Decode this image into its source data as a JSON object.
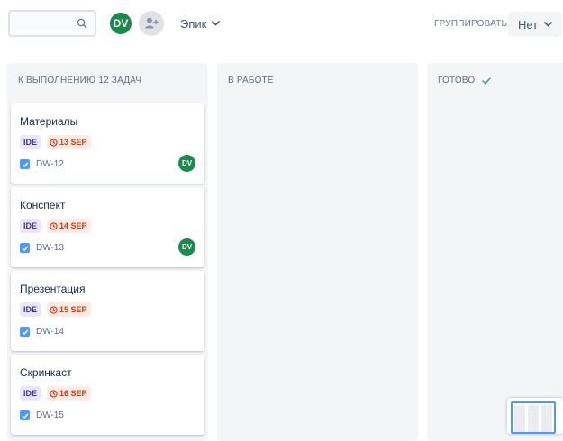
{
  "toolbar": {
    "search": {
      "value": "",
      "placeholder": ""
    },
    "avatar_initials": "DV",
    "epic_label": "Эпик",
    "group_label": "ГРУППИРОВАТЬ:",
    "group_value": "Нет"
  },
  "icons": {
    "search": "search-icon",
    "add_people": "add-people-icon",
    "chevron": "chevron-down-icon",
    "clock": "clock-icon",
    "checkbox": "checkbox-checked-icon",
    "done_check": "check-icon"
  },
  "columns": [
    {
      "title": "К ВЫПОЛНЕНИЮ 12 ЗАДАЧ"
    },
    {
      "title": "В РАБОТЕ"
    },
    {
      "title": "ГОТОВО"
    }
  ],
  "cards": [
    {
      "title": "Материалы",
      "epic": "IDE",
      "due": "13 SEP",
      "key": "DW-12",
      "assignee": "DV"
    },
    {
      "title": "Конспект",
      "epic": "IDE",
      "due": "14 SEP",
      "key": "DW-13",
      "assignee": "DV"
    },
    {
      "title": "Презентация",
      "epic": "IDE",
      "due": "15 SEP",
      "key": "DW-14",
      "assignee": ""
    },
    {
      "title": "Скринкаст",
      "epic": "IDE",
      "due": "16 SEP",
      "key": "DW-15",
      "assignee": ""
    }
  ],
  "colors": {
    "avatar": "#1c8a4c",
    "epic_bg": "#eae6ff",
    "epic_text": "#403294",
    "due_bg": "#ffebe6",
    "due_text": "#de350b",
    "checkbox": "#4c9aff",
    "done_check": "#36b37e",
    "column_bg": "#f4f5f7"
  }
}
